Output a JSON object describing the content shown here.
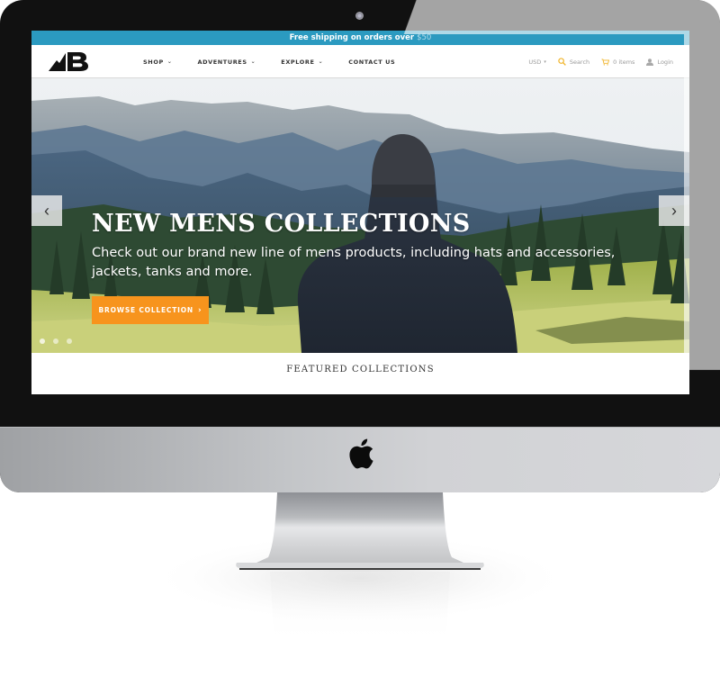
{
  "device": {
    "type": "desktop-monitor",
    "logo_icon": "apple-logo-icon"
  },
  "site": {
    "announcement": {
      "text": "Free shipping on orders over",
      "amount": "$50"
    },
    "logo_icon": "mountain-b-logo-icon",
    "nav": [
      {
        "label": "SHOP",
        "has_dropdown": true
      },
      {
        "label": "ADVENTURES",
        "has_dropdown": true
      },
      {
        "label": "EXPLORE",
        "has_dropdown": true
      },
      {
        "label": "CONTACT US",
        "has_dropdown": false
      }
    ],
    "utilities": {
      "currency": "USD",
      "search_label": "Search",
      "cart_label": "0 items",
      "login_label": "Login"
    },
    "hero": {
      "title": "NEW MENS COLLECTIONS",
      "subtitle": "Check out our brand new line of mens products, including hats and accessories, jackets, tanks and more.",
      "button_label": "BROWSE COLLECTION",
      "button_chevron": "›",
      "prev_arrow": "‹",
      "next_arrow": "›",
      "slide_count": 3,
      "active_slide": 1
    },
    "featured_heading": "FEATURED COLLECTIONS"
  },
  "colors": {
    "announcement_bg": "#2b9ac0",
    "button_bg": "#f7941d",
    "search_icon": "#f0b429",
    "bezel": "#111111",
    "chin": "#c3c5c8"
  }
}
